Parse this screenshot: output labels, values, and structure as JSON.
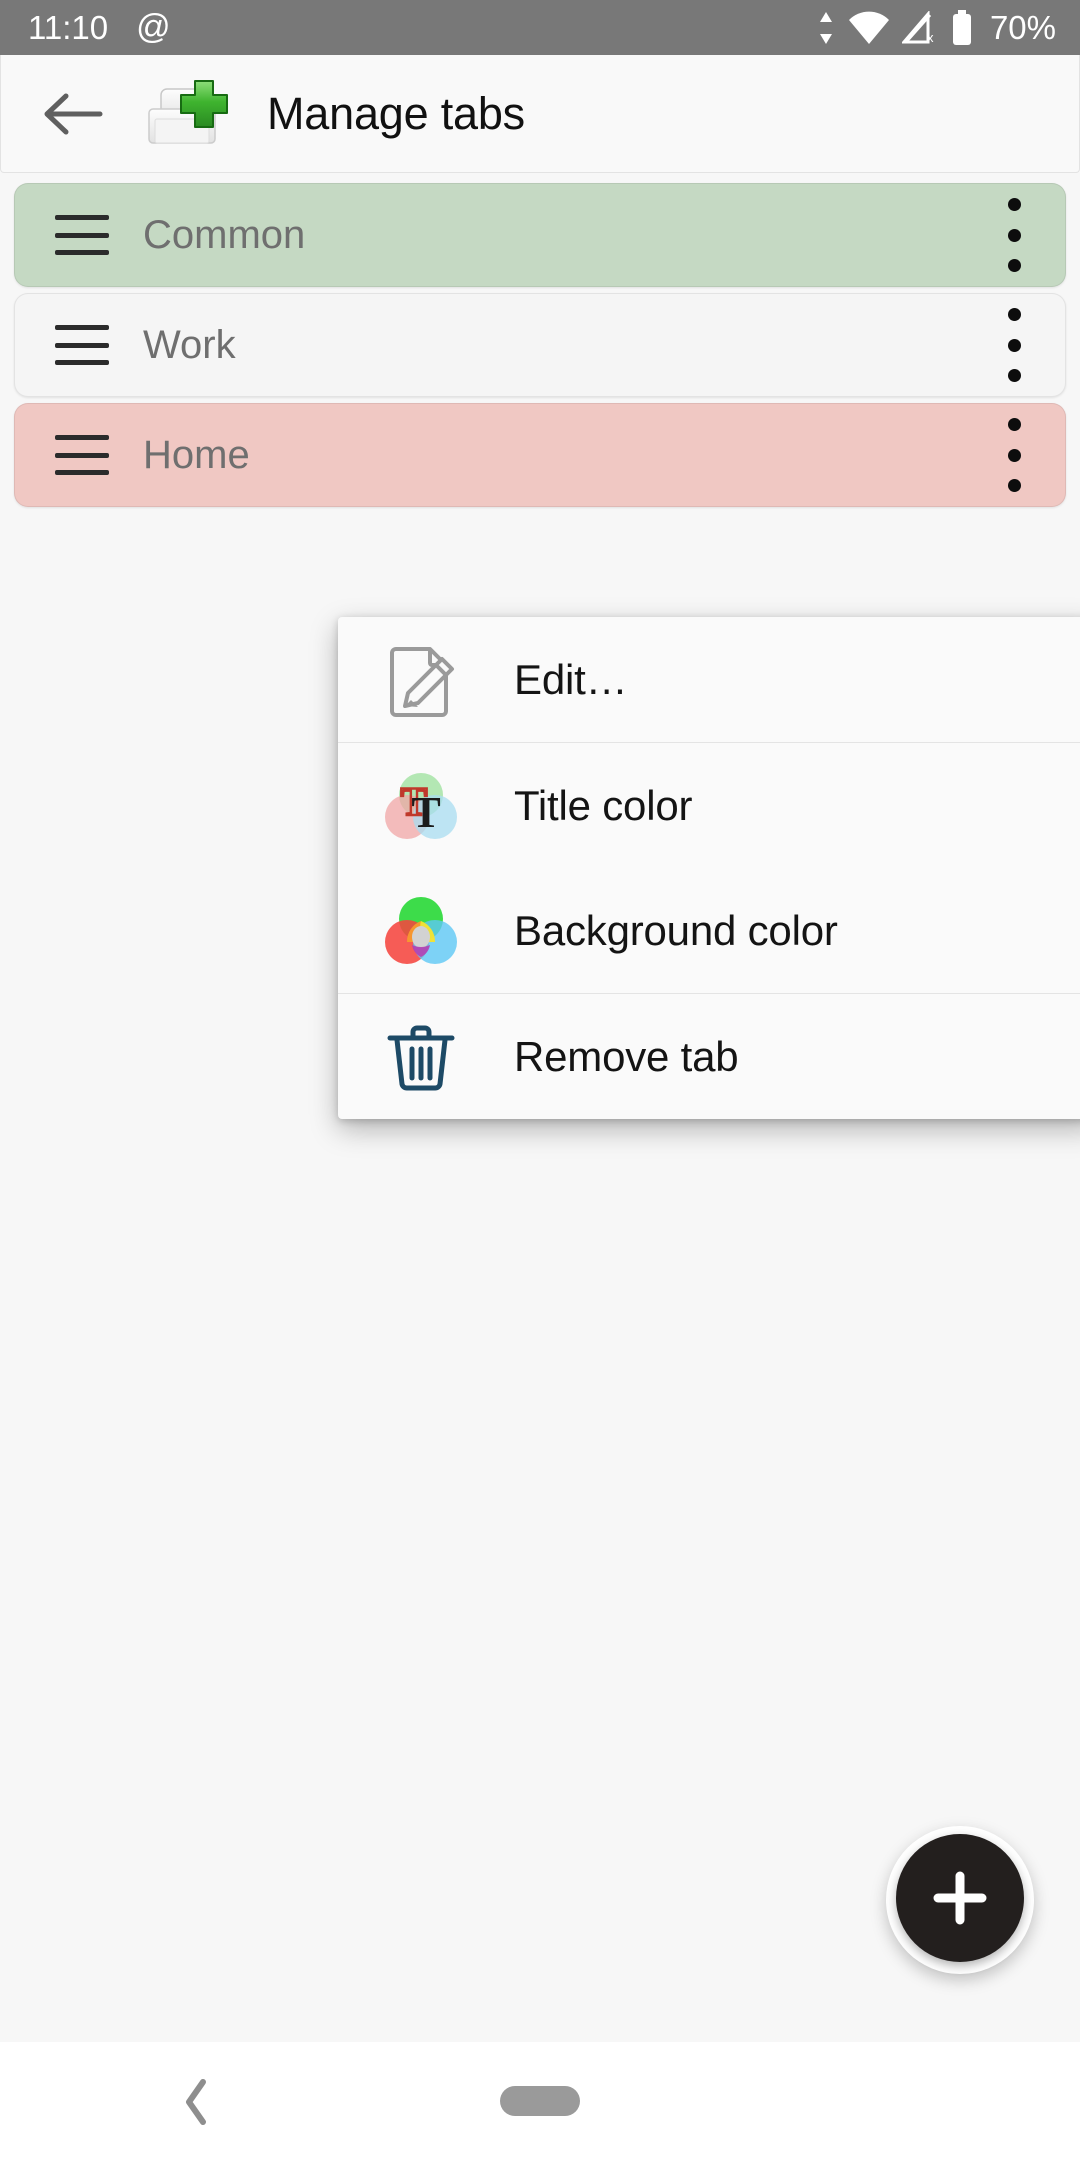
{
  "status_bar": {
    "time": "11:10",
    "at_icon": "@",
    "battery_percent": "70%",
    "icons": [
      "at-sign-icon",
      "data-transfer-icon",
      "wifi-icon",
      "cellular-no-signal-icon",
      "battery-icon"
    ],
    "background_color": "#787878",
    "text_color": "#ffffff"
  },
  "app_bar": {
    "back_label": "back-arrow",
    "icon_name": "add-tab-folder-icon",
    "title": "Manage tabs",
    "background_color": "#f9f9f9"
  },
  "tabs": [
    {
      "name": "Common",
      "background_color": "#c5d9c3",
      "selected": true,
      "handle": "drag-handle-icon",
      "menu": "overflow-menu-icon"
    },
    {
      "name": "Work",
      "background_color": "#f5f5f5",
      "selected": false,
      "handle": "drag-handle-icon",
      "menu": "overflow-menu-icon"
    },
    {
      "name": "Home",
      "background_color": "#f0c8c3",
      "selected": false,
      "handle": "drag-handle-icon",
      "menu": "overflow-menu-icon"
    }
  ],
  "popup_menu": {
    "open_for_tab": "Home",
    "items": [
      {
        "label": "Edit…",
        "icon": "edit-document-pencil-icon"
      },
      {
        "label": "Title color",
        "icon": "title-color-venn-icon"
      },
      {
        "label": "Background color",
        "icon": "background-color-venn-icon"
      },
      {
        "label": "Remove tab",
        "icon": "trash-can-icon"
      }
    ]
  },
  "fab": {
    "label": "+",
    "name": "add-tab-fab",
    "background_color": "#231f1e",
    "icon_color": "#ffffff"
  },
  "bottom_nav": {
    "back": "nav-back-chevron",
    "home": "nav-home-pill"
  },
  "colors": {
    "accent_green": "#3fb83f",
    "tab_selected": "#c5d9c3",
    "tab_home": "#f0c8c3",
    "trash_icon": "#1d4a66",
    "page_background": "#f7f7f7"
  }
}
